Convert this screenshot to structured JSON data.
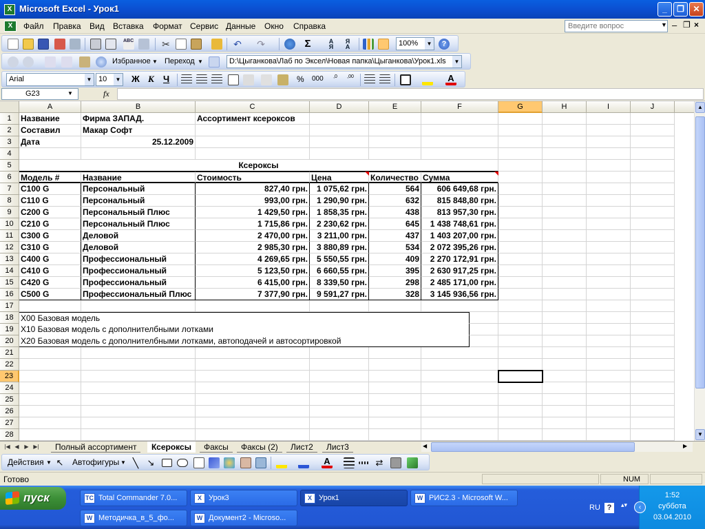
{
  "window": {
    "title": "Microsoft Excel - Урок1",
    "min": "_",
    "max": "❐",
    "close": "✕"
  },
  "menu": {
    "items": [
      "Файл",
      "Правка",
      "Вид",
      "Вставка",
      "Формат",
      "Сервис",
      "Данные",
      "Окно",
      "Справка"
    ],
    "ask_placeholder": "Введите вопрос"
  },
  "toolbar": {
    "zoom": "100%",
    "favorites": "Избранное",
    "goto": "Переход",
    "path": "D:\\Цыганкова\\Лаб по Эксел\\Новая папка\\Цыганкова\\Урок1.xls",
    "font": "Arial",
    "size": "10",
    "bold": "Ж",
    "italic": "К",
    "underline": "Ч",
    "percent": "%",
    "thousands": "000"
  },
  "formula_bar": {
    "name_box": "G23",
    "fx": "fx",
    "content": ""
  },
  "columns": [
    "A",
    "B",
    "C",
    "D",
    "E",
    "F",
    "G",
    "H",
    "I",
    "J"
  ],
  "selected_cell": {
    "column": "G",
    "row": 23
  },
  "sheet": {
    "r1": {
      "A": "Название",
      "B": "Фирма ЗАПАД.",
      "C": "Ассортимент ксероксов"
    },
    "r2": {
      "A": "Составил",
      "B": "Макар Софт"
    },
    "r3": {
      "A": "Дата",
      "B": "25.12.2009"
    },
    "r5": {
      "title": "Ксероксы"
    },
    "headers": [
      "Модель #",
      "Название",
      "Стоимость",
      "Цена",
      "Количество",
      "Сумма"
    ],
    "rows": [
      [
        "C100 G",
        "Персональный",
        "827,40 грн.",
        "1 075,62 грн.",
        "564",
        "606 649,68 грн."
      ],
      [
        "C110 G",
        "Персональный",
        "993,00 грн.",
        "1 290,90 грн.",
        "632",
        "815 848,80 грн."
      ],
      [
        "C200 G",
        "Персональный Плюс",
        "1 429,50 грн.",
        "1 858,35 грн.",
        "438",
        "813 957,30 грн."
      ],
      [
        "C210 G",
        "Персональный Плюс",
        "1 715,86 грн.",
        "2 230,62 грн.",
        "645",
        "1 438 748,61 грн."
      ],
      [
        "C300 G",
        "Деловой",
        "2 470,00 грн.",
        "3 211,00 грн.",
        "437",
        "1 403 207,00 грн."
      ],
      [
        "C310 G",
        "Деловой",
        "2 985,30 грн.",
        "3 880,89 грн.",
        "534",
        "2 072 395,26 грн."
      ],
      [
        "C400 G",
        "Профессиональный",
        "4 269,65 грн.",
        "5 550,55 грн.",
        "409",
        "2 270 172,91 грн."
      ],
      [
        "C410 G",
        "Профессиональный",
        "5 123,50 грн.",
        "6 660,55 грн.",
        "395",
        "2 630 917,25 грн."
      ],
      [
        "C420 G",
        "Профессиональный",
        "6 415,00 грн.",
        "8 339,50 грн.",
        "298",
        "2 485 171,00 грн."
      ],
      [
        "C500 G",
        "Профессиональный Плюс",
        "7 377,90 грн.",
        "9 591,27 грн.",
        "328",
        "3 145 936,56 грн."
      ]
    ],
    "notes": [
      "X00 Базовая модель",
      "X10 Базовая модель с дополнителбными лотками",
      "X20 Базовая модель с дополнителбными лотками, автоподачей и автосортировкой"
    ]
  },
  "sheet_tabs": [
    "Полный ассортимент",
    "Ксероксы",
    "Факсы",
    "Факсы (2)",
    "Лист2",
    "Лист3"
  ],
  "active_tab_index": 1,
  "drawing_toolbar": {
    "actions": "Действия",
    "autoshapes": "Автофигуры"
  },
  "status": {
    "text": "Готово",
    "num": "NUM"
  },
  "taskbar": {
    "start": "пуск",
    "tasks_row1": [
      "Total Commander 7.0...",
      "Урок3",
      "Урок1",
      "РИС2.3 - Microsoft W..."
    ],
    "tasks_row2": [
      "Методичка_в_5_фо...",
      "Документ2 - Microso..."
    ],
    "active_task": "Урок1",
    "lang": "RU",
    "time": "1:52",
    "day": "суббота",
    "date": "03.04.2010"
  },
  "colors": {
    "title_bar": "#0b4fd1",
    "selection_header": "#ffc870",
    "comment_marker": "#e00000",
    "taskbar": "#2257d4",
    "start": "#3c8f37"
  },
  "icons": [
    "excel-app-icon",
    "new-icon",
    "open-icon",
    "save-icon",
    "print-icon",
    "preview-icon",
    "spell-icon",
    "cut-icon",
    "copy-icon",
    "paste-icon",
    "undo-icon",
    "redo-icon",
    "hyperlink-icon",
    "sum-icon",
    "sort-asc-icon",
    "sort-desc-icon",
    "chart-icon",
    "drawing-icon",
    "help-icon",
    "back-icon",
    "forward-icon",
    "stop-icon",
    "refresh-icon",
    "home-icon",
    "search-web-icon",
    "align-left-icon",
    "center-icon",
    "align-right-icon",
    "merge-icon",
    "currency-icon",
    "border-icon",
    "fill-color-icon",
    "font-color-icon",
    "pointer-icon",
    "line-icon",
    "arrow-icon",
    "rectangle-icon",
    "oval-icon",
    "textbox-icon",
    "wordart-icon",
    "shadow-icon",
    "3d-icon"
  ]
}
